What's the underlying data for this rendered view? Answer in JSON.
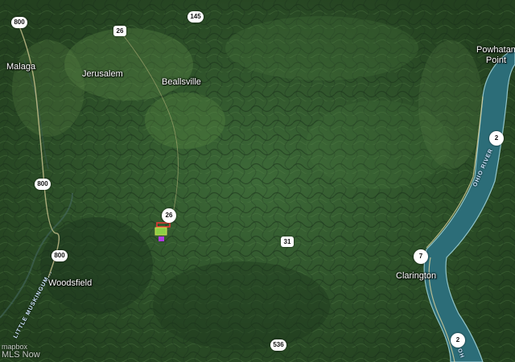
{
  "map": {
    "colors": {
      "terrain_dark": "#1f3a20",
      "terrain_mid": "#2f5530",
      "terrain_light": "#4f7c42",
      "river": "#2c6d78",
      "river_edge": "#8fc3c8",
      "road": "#d9cf9a",
      "parcel_outline": "#e53935",
      "parcel_fill": "#9be34a",
      "parcel_marker": "#b03be0"
    },
    "towns": [
      {
        "id": "malaga",
        "label": "Malaga"
      },
      {
        "id": "jerusalem",
        "label": "Jerusalem"
      },
      {
        "id": "beallsville",
        "label": "Beallsville"
      },
      {
        "id": "powhatan",
        "label": "Powhatan\nPoint"
      },
      {
        "id": "woodsfield",
        "label": "Woodsfield"
      },
      {
        "id": "clarington",
        "label": "Clarington"
      }
    ],
    "route_shields": [
      {
        "id": "r800a",
        "label": "800"
      },
      {
        "id": "r26a",
        "label": "26"
      },
      {
        "id": "r145",
        "label": "145"
      },
      {
        "id": "r2a",
        "label": "2"
      },
      {
        "id": "r800b",
        "label": "800"
      },
      {
        "id": "r26b",
        "label": "26"
      },
      {
        "id": "r31",
        "label": "31"
      },
      {
        "id": "r800c",
        "label": "800"
      },
      {
        "id": "r7",
        "label": "7"
      },
      {
        "id": "r536",
        "label": "536"
      },
      {
        "id": "r2b",
        "label": "2"
      }
    ],
    "river_labels": {
      "ohio": "OHIO RIVER",
      "creek": "LITTLE MUSKINGUM... ",
      "ohio_short": "OH"
    },
    "attribution": {
      "logo": "mapbox",
      "source": "MLS Now"
    }
  }
}
